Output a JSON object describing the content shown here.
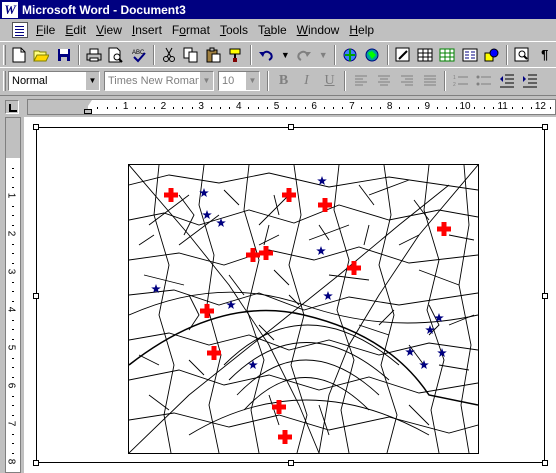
{
  "window": {
    "title": "Microsoft Word - Document3",
    "app_icon": "W"
  },
  "menu": {
    "items": [
      {
        "label": "File",
        "u": "F",
        "rest": "ile"
      },
      {
        "label": "Edit",
        "u": "E",
        "rest": "dit"
      },
      {
        "label": "View",
        "u": "V",
        "rest": "iew"
      },
      {
        "label": "Insert",
        "u": "I",
        "rest": "nsert"
      },
      {
        "label": "Format",
        "pre": "F",
        "u": "o",
        "rest": "rmat"
      },
      {
        "label": "Tools",
        "u": "T",
        "rest": "ools"
      },
      {
        "label": "Table",
        "pre": "T",
        "u": "a",
        "rest": "ble"
      },
      {
        "label": "Window",
        "u": "W",
        "rest": "indow"
      },
      {
        "label": "Help",
        "u": "H",
        "rest": "elp"
      }
    ]
  },
  "formatting": {
    "style": "Normal",
    "font": "Times New Roman",
    "size": "10",
    "bold": "B",
    "italic": "I",
    "underline": "U"
  },
  "ruler": {
    "h_numbers": [
      "1",
      "2",
      "3",
      "4",
      "5",
      "6",
      "7",
      "8",
      "9",
      "10",
      "11",
      "12"
    ],
    "v_numbers": [
      "1",
      "2",
      "3",
      "4",
      "5",
      "6",
      "7",
      "8"
    ]
  },
  "map": {
    "colors": {
      "hospital": "#ff0000",
      "star": "#000080",
      "streets": "#000000"
    },
    "legend_icons": [
      "red-cross-icon",
      "blue-star-icon"
    ]
  }
}
